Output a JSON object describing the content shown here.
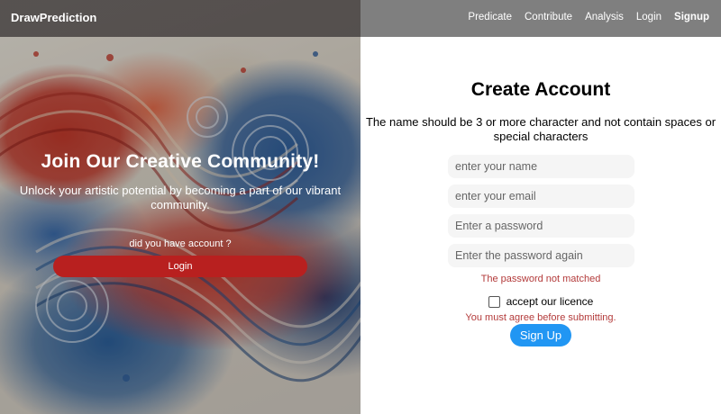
{
  "nav": {
    "brand": "DrawPrediction",
    "links": [
      {
        "label": "Predicate"
      },
      {
        "label": "Contribute"
      },
      {
        "label": "Analysis"
      },
      {
        "label": "Login"
      },
      {
        "label": "Signup"
      }
    ]
  },
  "hero": {
    "title": "Join Our Creative Community!",
    "subtitle": "Unlock your artistic potential by becoming a part of our vibrant community.",
    "question": "did you have account ?",
    "login_button": "Login"
  },
  "form": {
    "title": "Create Account",
    "description": "The name should be 3 or more character and not contain spaces or special characters",
    "name_placeholder": "enter your name",
    "email_placeholder": "enter your email",
    "password_placeholder": "Enter a password",
    "password_again_placeholder": "Enter the password again",
    "password_error": "The password not matched",
    "licence_label": "accept our licence",
    "licence_error": "You must agree before submitting.",
    "signup_button": "Sign Up"
  },
  "colors": {
    "login_button": "#b8201f",
    "signup_button": "#2196f3",
    "error_text": "#b33a3a"
  }
}
